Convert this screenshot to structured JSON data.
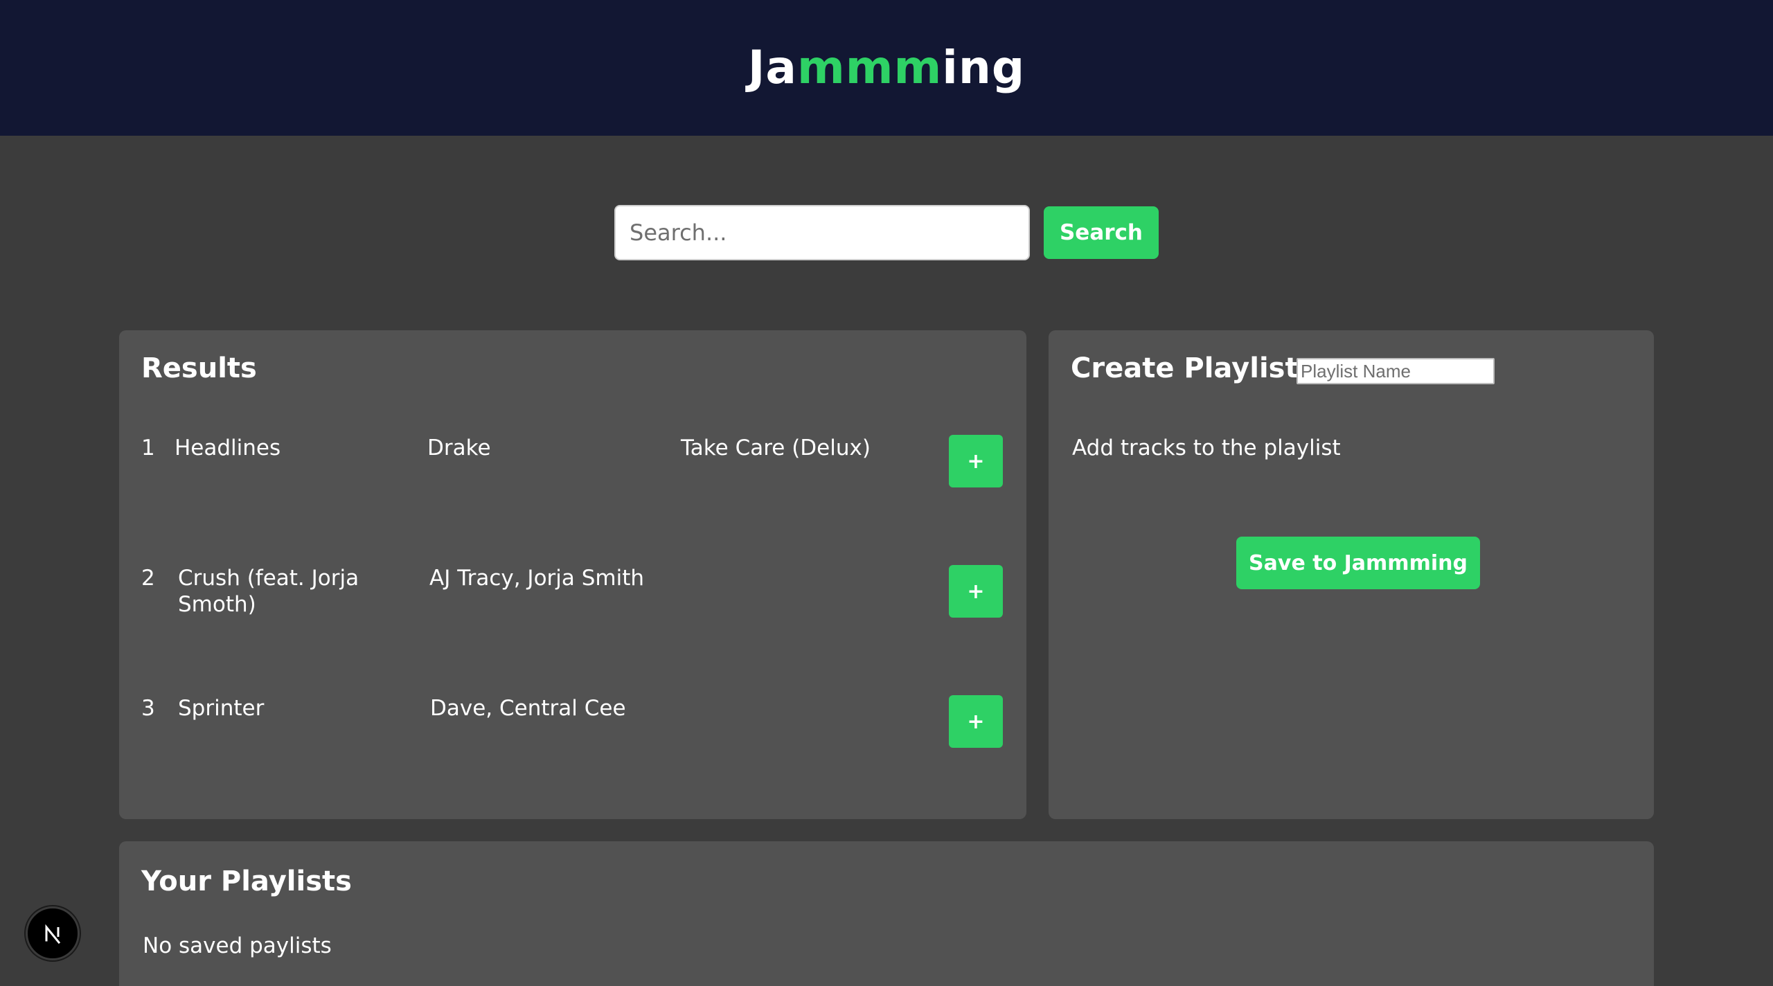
{
  "header": {
    "brand_part1": "Ja",
    "brand_accent": "mmm",
    "brand_part2": "ing"
  },
  "search": {
    "placeholder": "Search...",
    "value": "",
    "button_label": "Search"
  },
  "results": {
    "title": "Results",
    "add_label": "+",
    "tracks": [
      {
        "number": "1",
        "title": "Headlines",
        "artist": "Drake",
        "album": "Take Care (Delux)"
      },
      {
        "number": "2",
        "title": "Crush (feat. Jorja Smoth)",
        "artist": "AJ Tracy, Jorja Smith",
        "album": ""
      },
      {
        "number": "3",
        "title": "Sprinter",
        "artist": "Dave, Central Cee",
        "album": ""
      }
    ]
  },
  "create_playlist": {
    "title": "Create Playlist",
    "name_placeholder": "Playlist Name",
    "name_value": "",
    "empty_text": "Add tracks to the playlist",
    "save_label": "Save to Jammming"
  },
  "your_playlists": {
    "title": "Your Playlists",
    "empty_text": "No saved paylists"
  },
  "dev_indicator": {
    "icon": "nextjs-logo-icon",
    "letter": "N"
  },
  "colors": {
    "header_bg": "#121733",
    "page_bg": "#3c3c3c",
    "panel_bg": "#525252",
    "accent": "#2ed165",
    "text": "#ffffff"
  }
}
